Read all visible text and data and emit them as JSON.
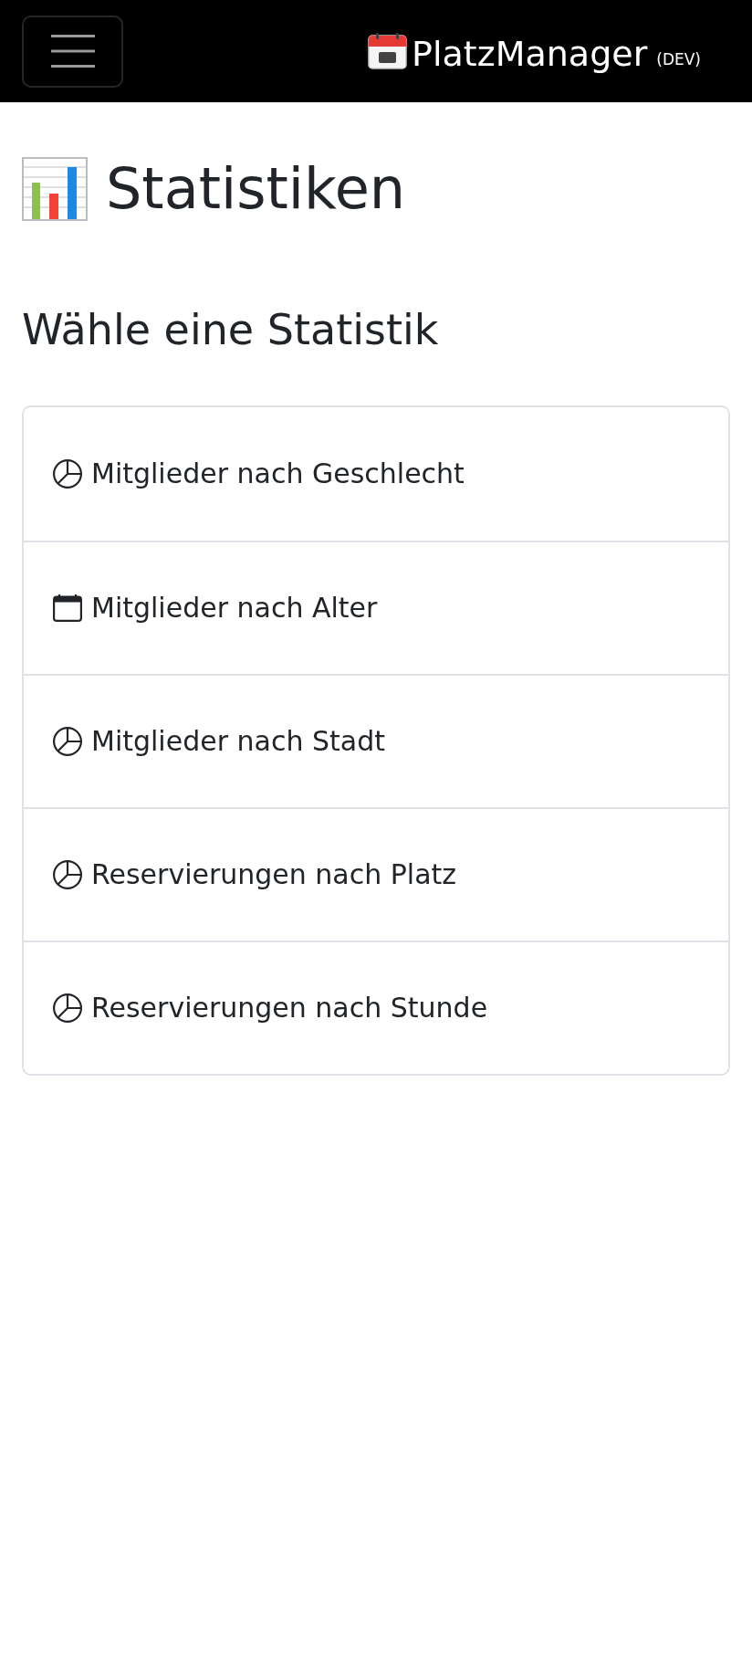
{
  "navbar": {
    "brand": {
      "title": "PlatzManager",
      "environment": "(DEV)"
    }
  },
  "heading": {
    "title": "Statistiken"
  },
  "section": {
    "title": "Wähle eine Statistik",
    "items": [
      {
        "kind": "pie",
        "label": "Mitglieder nach Geschlecht"
      },
      {
        "kind": "calendar",
        "label": "Mitglieder nach Alter"
      },
      {
        "kind": "pie",
        "label": "Mitglieder nach Stadt"
      },
      {
        "kind": "pie",
        "label": "Reservierungen nach Platz"
      },
      {
        "kind": "pie",
        "label": "Reservierungen nach Stunde"
      }
    ]
  }
}
